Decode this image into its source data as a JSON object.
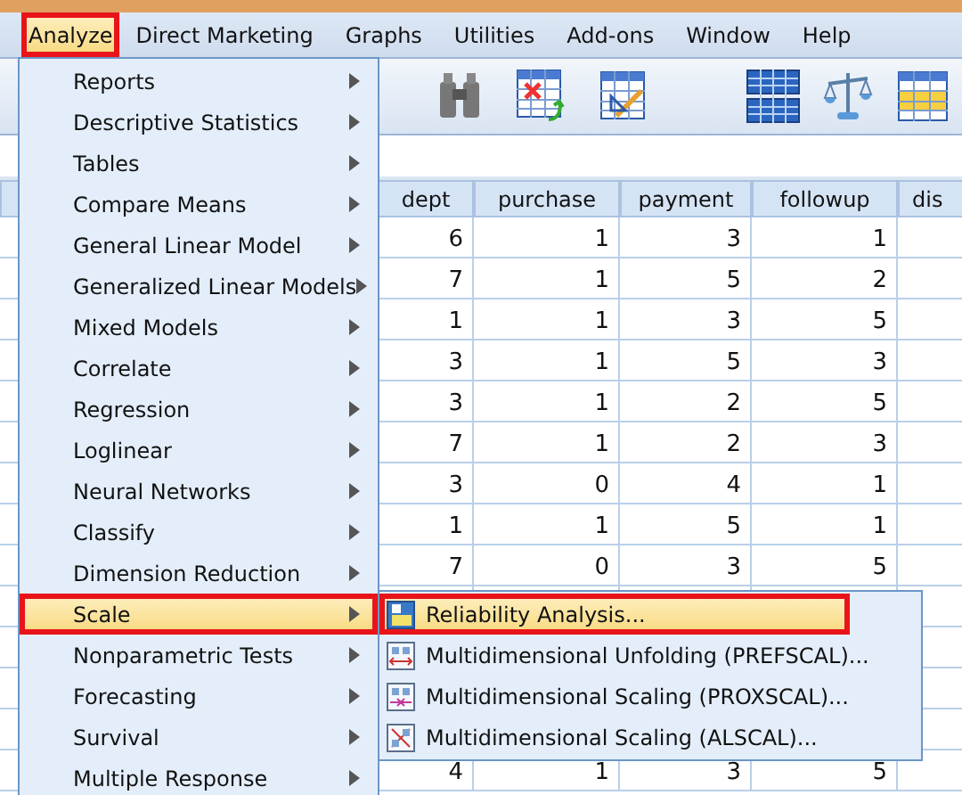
{
  "menu_bar": [
    {
      "label": "Analyze",
      "selected": true
    },
    {
      "label": "Direct Marketing",
      "selected": false
    },
    {
      "label": "Graphs",
      "selected": false
    },
    {
      "label": "Utilities",
      "selected": false
    },
    {
      "label": "Add-ons",
      "selected": false
    },
    {
      "label": "Window",
      "selected": false
    },
    {
      "label": "Help",
      "selected": false
    }
  ],
  "table": {
    "columns": [
      "dept",
      "purchase",
      "payment",
      "followup",
      "dis"
    ],
    "rows": [
      [
        "6",
        "1",
        "3",
        "1"
      ],
      [
        "7",
        "1",
        "5",
        "2"
      ],
      [
        "1",
        "1",
        "3",
        "5"
      ],
      [
        "3",
        "1",
        "5",
        "3"
      ],
      [
        "3",
        "1",
        "2",
        "5"
      ],
      [
        "7",
        "1",
        "2",
        "3"
      ],
      [
        "3",
        "0",
        "4",
        "1"
      ],
      [
        "1",
        "1",
        "5",
        "1"
      ],
      [
        "7",
        "0",
        "3",
        "5"
      ]
    ],
    "bottom_rows": [
      [
        "4",
        "1",
        "3",
        "5"
      ]
    ]
  },
  "analyze_menu": {
    "items": [
      {
        "label": "Reports",
        "selected": false
      },
      {
        "label": "Descriptive Statistics",
        "selected": false
      },
      {
        "label": "Tables",
        "selected": false
      },
      {
        "label": "Compare Means",
        "selected": false
      },
      {
        "label": "General Linear Model",
        "selected": false
      },
      {
        "label": "Generalized Linear Models",
        "selected": false
      },
      {
        "label": "Mixed Models",
        "selected": false
      },
      {
        "label": "Correlate",
        "selected": false
      },
      {
        "label": "Regression",
        "selected": false
      },
      {
        "label": "Loglinear",
        "selected": false
      },
      {
        "label": "Neural Networks",
        "selected": false
      },
      {
        "label": "Classify",
        "selected": false
      },
      {
        "label": "Dimension Reduction",
        "selected": false
      },
      {
        "label": "Scale",
        "selected": true
      },
      {
        "label": "Nonparametric Tests",
        "selected": false
      },
      {
        "label": "Forecasting",
        "selected": false
      },
      {
        "label": "Survival",
        "selected": false
      },
      {
        "label": "Multiple Response",
        "selected": false
      }
    ]
  },
  "scale_submenu": {
    "items": [
      {
        "label": "Reliability Analysis...",
        "selected": true,
        "kind": "reliability"
      },
      {
        "label": "Multidimensional Unfolding (PREFSCAL)...",
        "selected": false,
        "kind": "unfolding"
      },
      {
        "label": "Multidimensional Scaling (PROXSCAL)...",
        "selected": false,
        "kind": "proxscal"
      },
      {
        "label": "Multidimensional Scaling (ALSCAL)...",
        "selected": false,
        "kind": "alscal"
      }
    ]
  }
}
